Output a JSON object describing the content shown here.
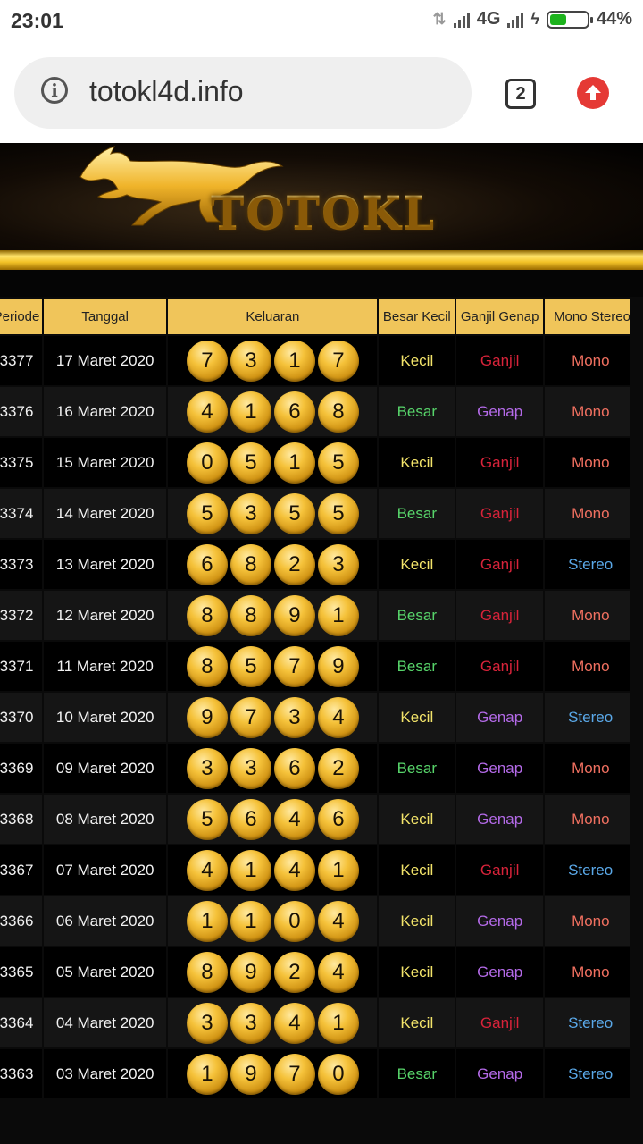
{
  "status_bar": {
    "time": "23:01",
    "network": "4G",
    "battery_percent": "44%",
    "battery_level": 0.44
  },
  "browser": {
    "url": "totokl4d.info",
    "tab_count": "2"
  },
  "site": {
    "logo_text": "TOTOKL"
  },
  "table": {
    "headers": [
      "Periode",
      "Tanggal",
      "Keluaran",
      "Besar Kecil",
      "Ganjil Genap",
      "Mono Stereo"
    ],
    "rows": [
      {
        "periode": "3377",
        "tanggal": "17 Maret 2020",
        "keluaran": [
          "7",
          "3",
          "1",
          "7"
        ],
        "besar_kecil": "Kecil",
        "ganjil_genap": "Ganjil",
        "mono_stereo": "Mono"
      },
      {
        "periode": "3376",
        "tanggal": "16 Maret 2020",
        "keluaran": [
          "4",
          "1",
          "6",
          "8"
        ],
        "besar_kecil": "Besar",
        "ganjil_genap": "Genap",
        "mono_stereo": "Mono"
      },
      {
        "periode": "3375",
        "tanggal": "15 Maret 2020",
        "keluaran": [
          "0",
          "5",
          "1",
          "5"
        ],
        "besar_kecil": "Kecil",
        "ganjil_genap": "Ganjil",
        "mono_stereo": "Mono"
      },
      {
        "periode": "3374",
        "tanggal": "14 Maret 2020",
        "keluaran": [
          "5",
          "3",
          "5",
          "5"
        ],
        "besar_kecil": "Besar",
        "ganjil_genap": "Ganjil",
        "mono_stereo": "Mono"
      },
      {
        "periode": "3373",
        "tanggal": "13 Maret 2020",
        "keluaran": [
          "6",
          "8",
          "2",
          "3"
        ],
        "besar_kecil": "Kecil",
        "ganjil_genap": "Ganjil",
        "mono_stereo": "Stereo"
      },
      {
        "periode": "3372",
        "tanggal": "12 Maret 2020",
        "keluaran": [
          "8",
          "8",
          "9",
          "1"
        ],
        "besar_kecil": "Besar",
        "ganjil_genap": "Ganjil",
        "mono_stereo": "Mono"
      },
      {
        "periode": "3371",
        "tanggal": "11 Maret 2020",
        "keluaran": [
          "8",
          "5",
          "7",
          "9"
        ],
        "besar_kecil": "Besar",
        "ganjil_genap": "Ganjil",
        "mono_stereo": "Mono"
      },
      {
        "periode": "3370",
        "tanggal": "10 Maret 2020",
        "keluaran": [
          "9",
          "7",
          "3",
          "4"
        ],
        "besar_kecil": "Kecil",
        "ganjil_genap": "Genap",
        "mono_stereo": "Stereo"
      },
      {
        "periode": "3369",
        "tanggal": "09 Maret 2020",
        "keluaran": [
          "3",
          "3",
          "6",
          "2"
        ],
        "besar_kecil": "Besar",
        "ganjil_genap": "Genap",
        "mono_stereo": "Mono"
      },
      {
        "periode": "3368",
        "tanggal": "08 Maret 2020",
        "keluaran": [
          "5",
          "6",
          "4",
          "6"
        ],
        "besar_kecil": "Kecil",
        "ganjil_genap": "Genap",
        "mono_stereo": "Mono"
      },
      {
        "periode": "3367",
        "tanggal": "07 Maret 2020",
        "keluaran": [
          "4",
          "1",
          "4",
          "1"
        ],
        "besar_kecil": "Kecil",
        "ganjil_genap": "Ganjil",
        "mono_stereo": "Stereo"
      },
      {
        "periode": "3366",
        "tanggal": "06 Maret 2020",
        "keluaran": [
          "1",
          "1",
          "0",
          "4"
        ],
        "besar_kecil": "Kecil",
        "ganjil_genap": "Genap",
        "mono_stereo": "Mono"
      },
      {
        "periode": "3365",
        "tanggal": "05 Maret 2020",
        "keluaran": [
          "8",
          "9",
          "2",
          "4"
        ],
        "besar_kecil": "Kecil",
        "ganjil_genap": "Genap",
        "mono_stereo": "Mono"
      },
      {
        "periode": "3364",
        "tanggal": "04 Maret 2020",
        "keluaran": [
          "3",
          "3",
          "4",
          "1"
        ],
        "besar_kecil": "Kecil",
        "ganjil_genap": "Ganjil",
        "mono_stereo": "Stereo"
      },
      {
        "periode": "3363",
        "tanggal": "03 Maret 2020",
        "keluaran": [
          "1",
          "9",
          "7",
          "0"
        ],
        "besar_kecil": "Besar",
        "ganjil_genap": "Genap",
        "mono_stereo": "Stereo"
      }
    ]
  }
}
